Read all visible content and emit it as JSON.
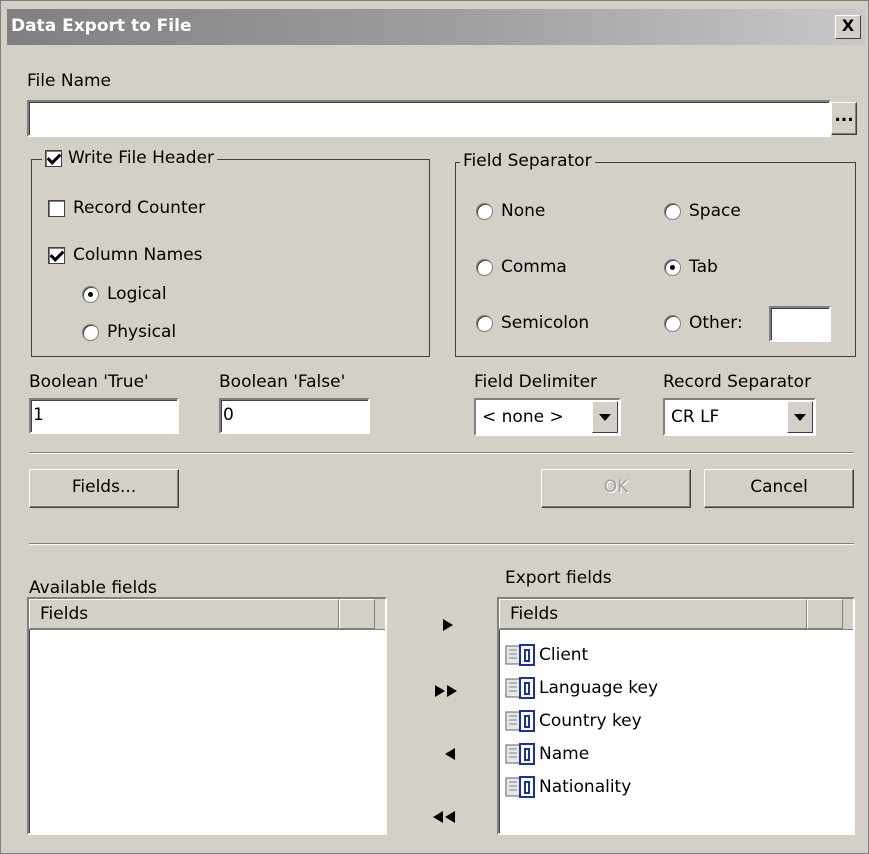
{
  "window": {
    "title": "Data Export to File",
    "close_label": "X"
  },
  "file_name": {
    "label": "File Name",
    "value": "",
    "browse_label": "..."
  },
  "file_header": {
    "legend": "Write File Header",
    "checked": true,
    "record_counter": {
      "label": "Record Counter",
      "checked": false
    },
    "column_names": {
      "label": "Column Names",
      "checked": true
    },
    "logical": {
      "label": "Logical",
      "selected": true
    },
    "physical": {
      "label": "Physical",
      "selected": false
    }
  },
  "field_separator": {
    "legend": "Field Separator",
    "options": [
      {
        "label": "None",
        "selected": false
      },
      {
        "label": "Space",
        "selected": false
      },
      {
        "label": "Comma",
        "selected": false
      },
      {
        "label": "Tab",
        "selected": true
      },
      {
        "label": "Semicolon",
        "selected": false
      },
      {
        "label": "Other:",
        "selected": false
      }
    ],
    "other_value": ""
  },
  "boolean_true": {
    "label": "Boolean 'True'",
    "value": "1"
  },
  "boolean_false": {
    "label": "Boolean 'False'",
    "value": "0"
  },
  "field_delimiter": {
    "label": "Field Delimiter",
    "value": "< none >"
  },
  "record_separator": {
    "label": "Record Separator",
    "value": "CR LF"
  },
  "buttons": {
    "fields": "Fields...",
    "ok": "OK",
    "cancel": "Cancel"
  },
  "available_fields": {
    "label": "Available fields",
    "column_header": "Fields",
    "items": []
  },
  "export_fields": {
    "label": "Export fields",
    "column_header": "Fields",
    "items": [
      "Client",
      "Language key",
      "Country key",
      "Name",
      "Nationality"
    ]
  },
  "transfer_buttons": [
    "move-right",
    "move-all-right",
    "move-left",
    "move-all-left"
  ],
  "colors": {
    "dialog_bg": "#d4d0c8",
    "field_icon_blue": "#1a2fa0"
  }
}
